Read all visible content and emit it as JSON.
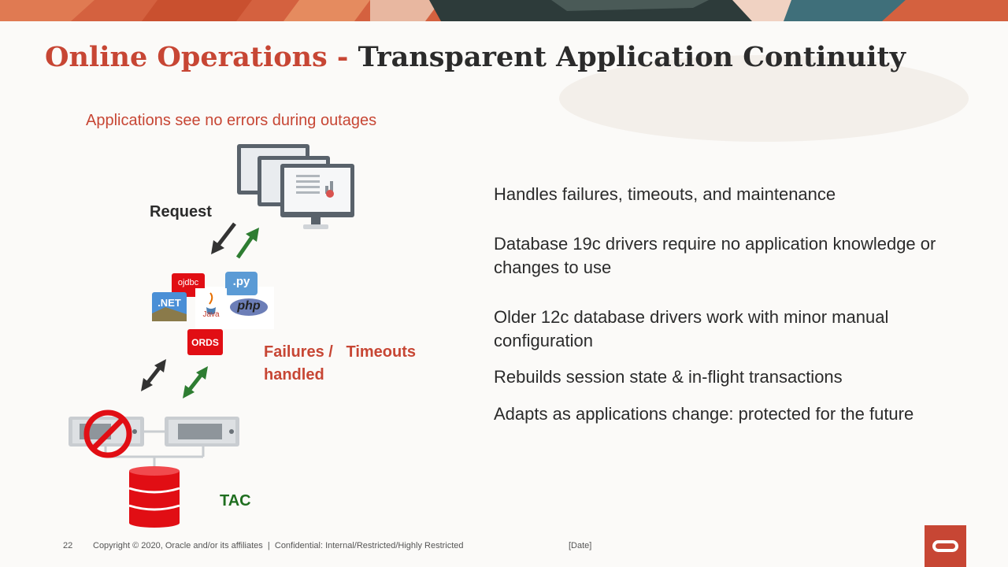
{
  "title": {
    "part1": "Online Operations",
    "separator": " - ",
    "part2": "Transparent Application Continuity"
  },
  "subtitle": "Applications see no errors during outages",
  "diagram": {
    "request_label": "Request",
    "failures_line1": "Failures /   Timeouts",
    "failures_line2": "handled",
    "tac_label": "TAC",
    "driver_labels": {
      "ojdbc": "ojdbc",
      "py": ".py",
      "net": ".NET",
      "java": "Java",
      "php": "php",
      "ords": "ORDS"
    }
  },
  "bullets": [
    "Handles failures, timeouts, and maintenance",
    "Database 19c drivers require no application knowledge or changes to use",
    "Older 12c database drivers work with minor manual configuration",
    "Rebuilds session state & in-flight transactions",
    "Adapts as applications change: protected for the future"
  ],
  "footer": {
    "page_number": "22",
    "copyright": "Copyright © 2020, Oracle and/or its affiliates  |  Confidential: Internal/Restricted/Highly Restricted",
    "date": "[Date]"
  },
  "colors": {
    "accent": "#c74634",
    "dark_text": "#2b2b2b",
    "green": "#1f6e1f",
    "arrow_dark": "#333333",
    "arrow_green": "#2e7d32"
  },
  "icons": [
    "monitor-stack-icon",
    "arrow-down-left-icon",
    "arrow-up-right-icon",
    "ojdbc-badge-icon",
    "python-badge-icon",
    "dotnet-badge-icon",
    "java-badge-icon",
    "php-badge-icon",
    "ords-badge-icon",
    "server-icon",
    "prohibited-icon",
    "database-cylinder-icon",
    "oracle-logo-icon"
  ]
}
